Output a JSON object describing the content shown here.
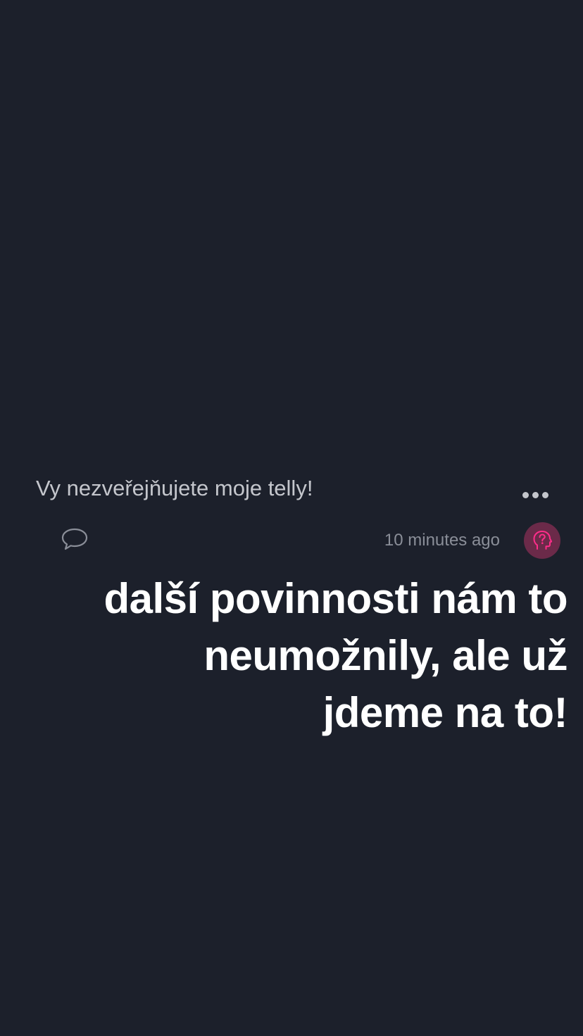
{
  "question": {
    "text": "Vy nezveřejňujete moje telly!"
  },
  "icons": {
    "more": "more-dots-icon",
    "comment": "comment-bubble-icon",
    "avatar": "anonymous-head-question-icon"
  },
  "meta": {
    "timestamp": "10 minutes ago"
  },
  "answer": {
    "lines": [
      "další povinnosti nám to",
      "neumožnily, ale už",
      "jdeme na to!"
    ]
  },
  "colors": {
    "background": "#1c202b",
    "avatar_bg": "#6b2a49",
    "avatar_icon": "#ff2d8a",
    "text_primary": "#ffffff",
    "text_secondary": "#c4c6cc",
    "text_muted": "#8a8e98"
  }
}
